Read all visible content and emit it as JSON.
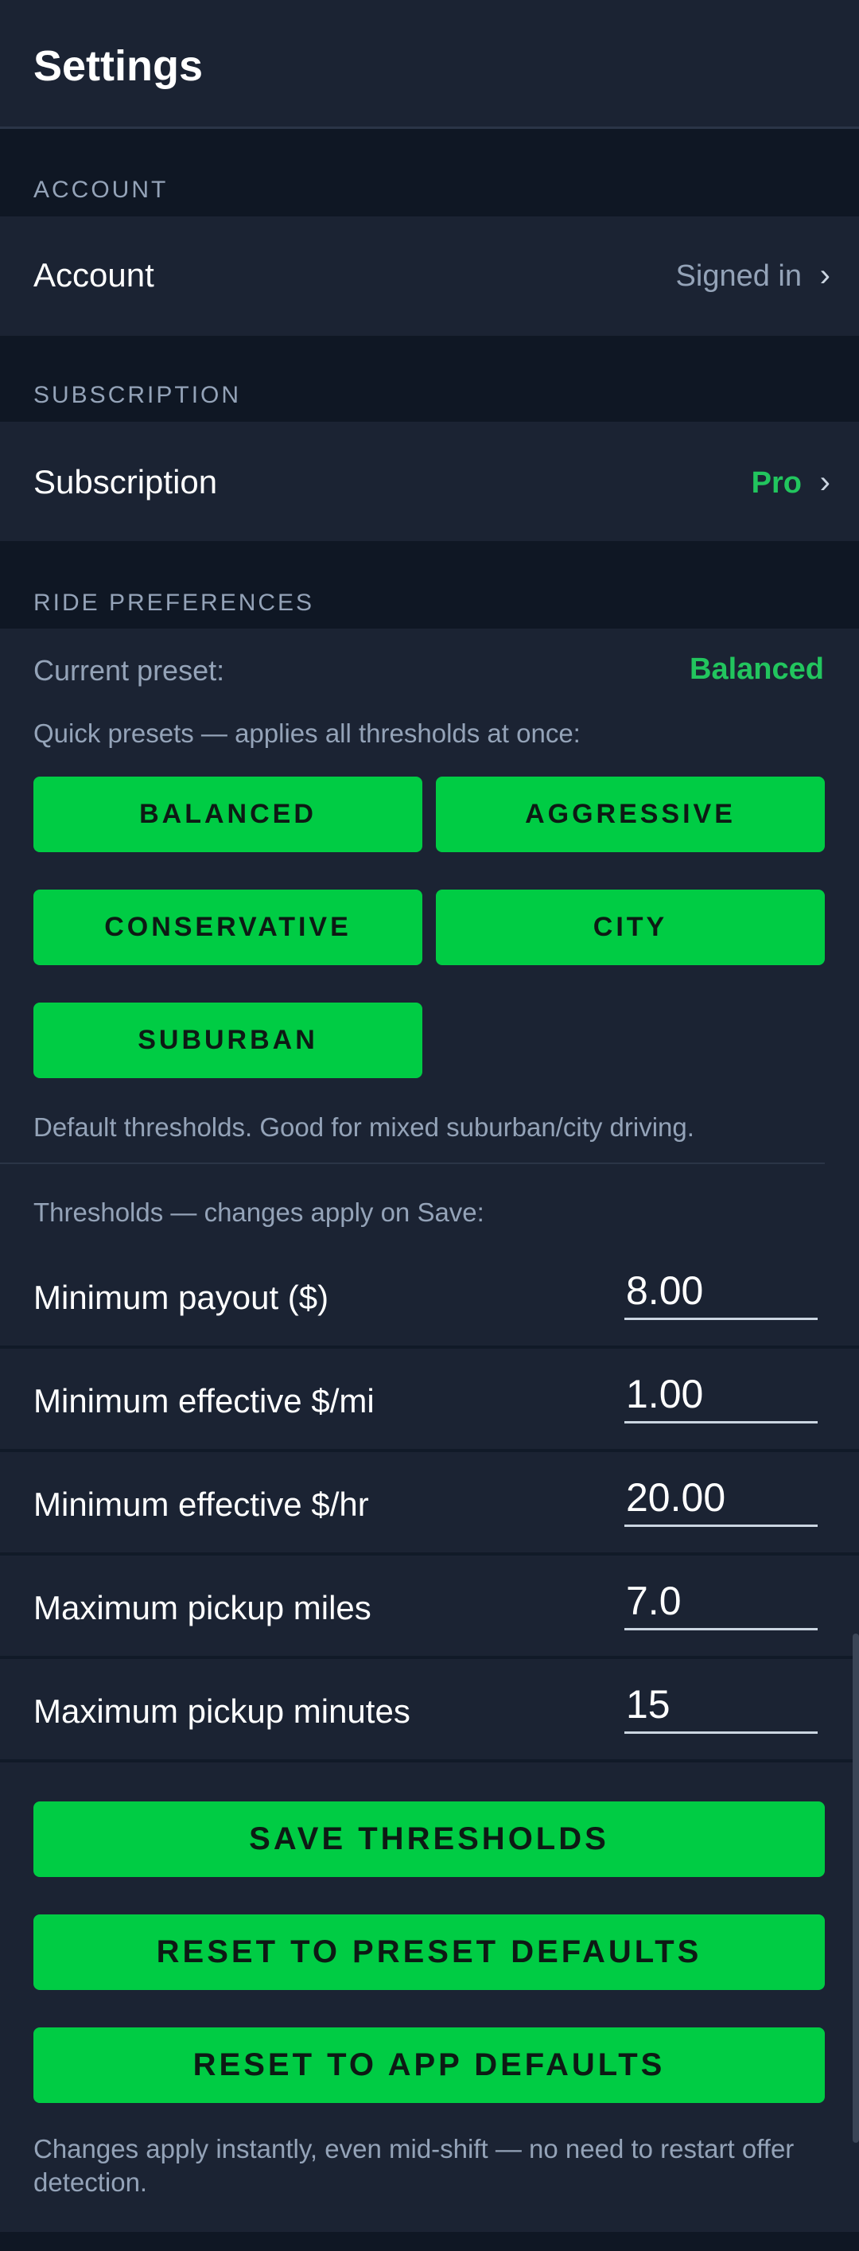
{
  "header": {
    "title": "Settings"
  },
  "sections": {
    "account_header": "ACCOUNT",
    "subscription_header": "SUBSCRIPTION",
    "ride_prefs_header": "RIDE PREFERENCES"
  },
  "account": {
    "label": "Account",
    "value": "Signed in",
    "chevron": "›"
  },
  "subscription": {
    "label": "Subscription",
    "value": "Pro",
    "chevron": "›"
  },
  "ride_preferences": {
    "current_preset_label": "Current preset:",
    "current_preset_value": "Balanced",
    "quick_presets_hint": "Quick presets — applies all thresholds at once:",
    "presets": [
      "BALANCED",
      "AGGRESSIVE",
      "CONSERVATIVE",
      "CITY",
      "SUBURBAN"
    ],
    "preset_description": "Default thresholds. Good for mixed suburban/city driving.",
    "thresholds_hint": "Thresholds — changes apply on Save:",
    "thresholds": [
      {
        "label": "Minimum payout ($)",
        "value": "8.00"
      },
      {
        "label": "Minimum effective $/mi",
        "value": "1.00"
      },
      {
        "label": "Minimum effective $/hr",
        "value": "20.00"
      },
      {
        "label": "Maximum pickup miles",
        "value": "7.0"
      },
      {
        "label": "Maximum pickup minutes",
        "value": "15"
      }
    ],
    "save_button": "SAVE THRESHOLDS",
    "reset_preset_button": "RESET TO PRESET DEFAULTS",
    "reset_app_button": "RESET TO APP DEFAULTS",
    "footer_note": "Changes apply instantly, even mid-shift — no need to restart offer detection."
  },
  "colors": {
    "accent_green": "#00cc44",
    "value_green": "#22c55e",
    "background": "#0f1724",
    "panel": "#1b2333"
  }
}
